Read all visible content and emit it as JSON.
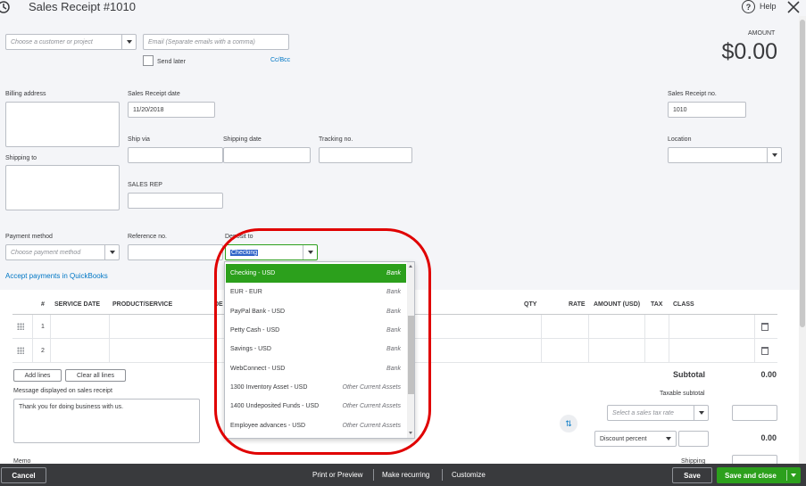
{
  "header": {
    "title": "Sales Receipt #1010",
    "help_label": "Help"
  },
  "customer": {
    "placeholder": "Choose a customer or project"
  },
  "email": {
    "placeholder": "Email (Separate emails with a comma)",
    "send_later": "Send later",
    "cc_bcc": "Cc/Bcc"
  },
  "amount": {
    "label": "AMOUNT",
    "value": "$0.00"
  },
  "labels": {
    "billing_address": "Billing address",
    "receipt_date": "Sales Receipt date",
    "receipt_no": "Sales Receipt no.",
    "ship_via": "Ship via",
    "shipping_date": "Shipping date",
    "tracking_no": "Tracking no.",
    "location": "Location",
    "shipping_to": "Shipping to",
    "sales_rep": "SALES REP",
    "payment_method": "Payment method",
    "reference_no": "Reference no.",
    "deposit_to": "Deposit to"
  },
  "values": {
    "receipt_date": "11/20/2018",
    "receipt_no": "1010",
    "deposit_to": "Checking"
  },
  "payment": {
    "placeholder": "Choose payment method"
  },
  "accept_payments": "Accept payments in QuickBooks",
  "dropdown": {
    "items": [
      {
        "name": "Checking - USD",
        "type": "Bank"
      },
      {
        "name": "EUR - EUR",
        "type": "Bank"
      },
      {
        "name": "PayPal Bank - USD",
        "type": "Bank"
      },
      {
        "name": "Petty Cash - USD",
        "type": "Bank"
      },
      {
        "name": "Savings - USD",
        "type": "Bank"
      },
      {
        "name": "WebConnect - USD",
        "type": "Bank"
      },
      {
        "name": "1300 Inventory Asset - USD",
        "type": "Other Current Assets"
      },
      {
        "name": "1400 Undeposited Funds - USD",
        "type": "Other Current Assets"
      },
      {
        "name": "Employee advances - USD",
        "type": "Other Current Assets"
      }
    ]
  },
  "table": {
    "headers": {
      "num": "#",
      "service_date": "SERVICE DATE",
      "product": "PRODUCT/SERVICE",
      "desc": "DE",
      "qty": "QTY",
      "rate": "RATE",
      "amount": "AMOUNT (USD)",
      "tax": "TAX",
      "class": "CLASS"
    },
    "rows": [
      "1",
      "2"
    ]
  },
  "buttons": {
    "add_lines": "Add lines",
    "clear_lines": "Clear all lines"
  },
  "message": {
    "label": "Message displayed on sales receipt",
    "value": "Thank you for doing business with us."
  },
  "memo_label": "Memo",
  "totals": {
    "subtotal_label": "Subtotal",
    "subtotal_value": "0.00",
    "taxable_label": "Taxable subtotal",
    "tax_placeholder": "Select a sales tax rate",
    "discount_type": "Discount percent",
    "discount_value": "0.00",
    "shipping_label": "Shipping"
  },
  "footer": {
    "cancel": "Cancel",
    "print": "Print or Preview",
    "recurring": "Make recurring",
    "customize": "Customize",
    "save": "Save",
    "save_close": "Save and close"
  },
  "colors": {
    "green": "#2ca01c",
    "footer": "#393a3d",
    "highlight": "#e00000"
  }
}
